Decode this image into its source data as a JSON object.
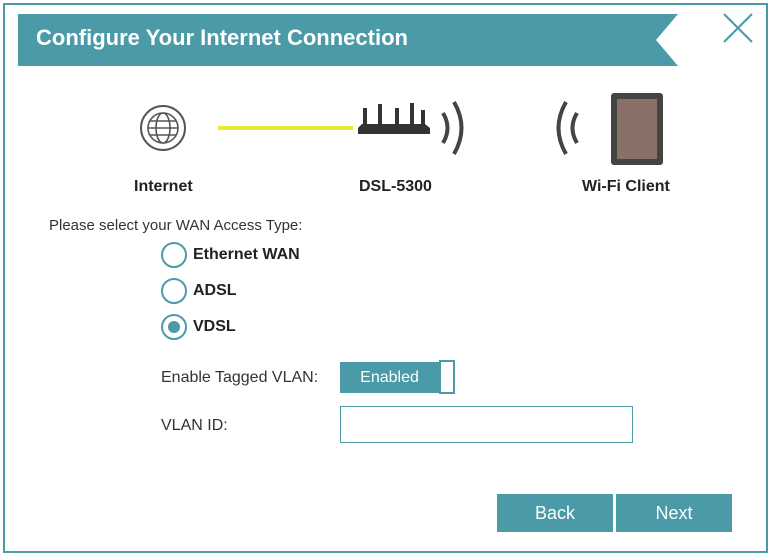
{
  "dialog": {
    "title": "Configure Your Internet Connection",
    "close_icon": "close-icon"
  },
  "diagram": {
    "internet_label": "Internet",
    "router_label": "DSL-5300",
    "client_label": "Wi-Fi Client",
    "icons": [
      "globe-icon",
      "router-icon",
      "wifi-waves-icon",
      "tablet-icon"
    ]
  },
  "wan": {
    "prompt": "Please select your WAN Access Type:",
    "options": [
      {
        "label": "Ethernet WAN",
        "selected": false
      },
      {
        "label": "ADSL",
        "selected": false
      },
      {
        "label": "VDSL",
        "selected": true
      }
    ]
  },
  "vlan": {
    "tagged_label": "Enable Tagged VLAN:",
    "toggle_text": "Enabled",
    "id_label": "VLAN ID:",
    "id_value": ""
  },
  "buttons": {
    "back": "Back",
    "next": "Next"
  },
  "colors": {
    "accent": "#4a9aa8",
    "connection_line": "#f0e733"
  }
}
